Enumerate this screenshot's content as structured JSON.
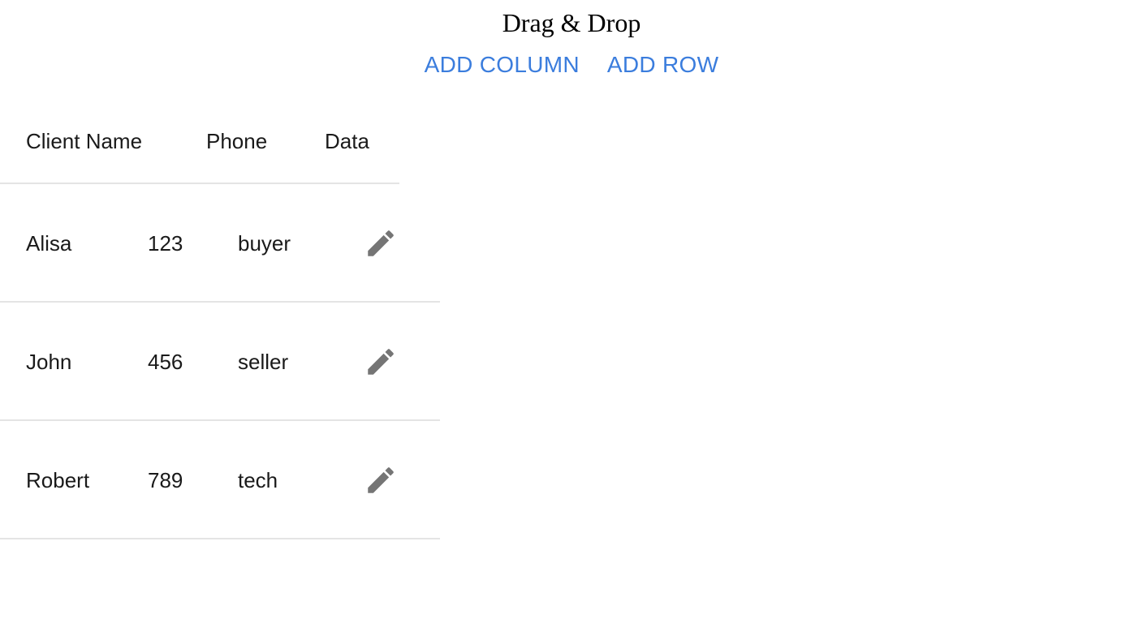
{
  "title": "Drag & Drop",
  "actions": {
    "add_column": "ADD COLUMN",
    "add_row": "ADD ROW"
  },
  "table": {
    "headers": [
      "Client Name",
      "Phone",
      "Data"
    ],
    "rows": [
      {
        "name": "Alisa",
        "phone": "123",
        "data": "buyer",
        "action_icon": "edit-icon"
      },
      {
        "name": "John",
        "phone": "456",
        "data": "seller",
        "action_icon": "edit-icon"
      },
      {
        "name": "Robert",
        "phone": "789",
        "data": "tech",
        "action_icon": "edit-icon"
      }
    ]
  },
  "colors": {
    "accent": "#3b7ddd",
    "icon": "#757575",
    "divider": "#e4e4e4"
  }
}
